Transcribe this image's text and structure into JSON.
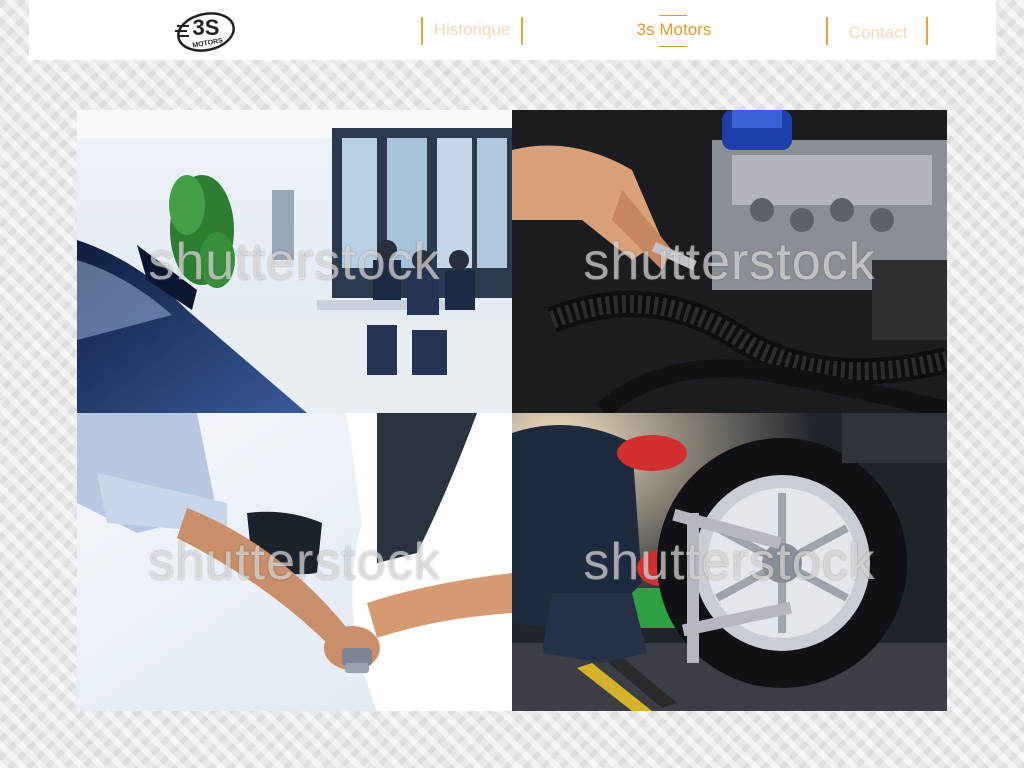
{
  "header": {
    "logo": {
      "text": "3S",
      "subtext": "MOTORS",
      "icon": "3s-motors-logo"
    },
    "nav": [
      {
        "label": "Historique",
        "state": "muted"
      },
      {
        "label": "3s Motors",
        "state": "active"
      },
      {
        "label": "Contact",
        "state": "muted"
      }
    ]
  },
  "colors": {
    "accent": "#d99a2b",
    "muted_text": "#f3d9b3",
    "separator": "#e3a23c",
    "header_bg": "#ffffff"
  },
  "gallery": [
    {
      "subject": "showroom-photo",
      "watermark": "shutterstock"
    },
    {
      "subject": "engine-repair-photo",
      "watermark": "shutterstock"
    },
    {
      "subject": "car-key-handover-photo",
      "watermark": "shutterstock"
    },
    {
      "subject": "wheel-alignment-photo",
      "watermark": "shutterstock"
    }
  ]
}
